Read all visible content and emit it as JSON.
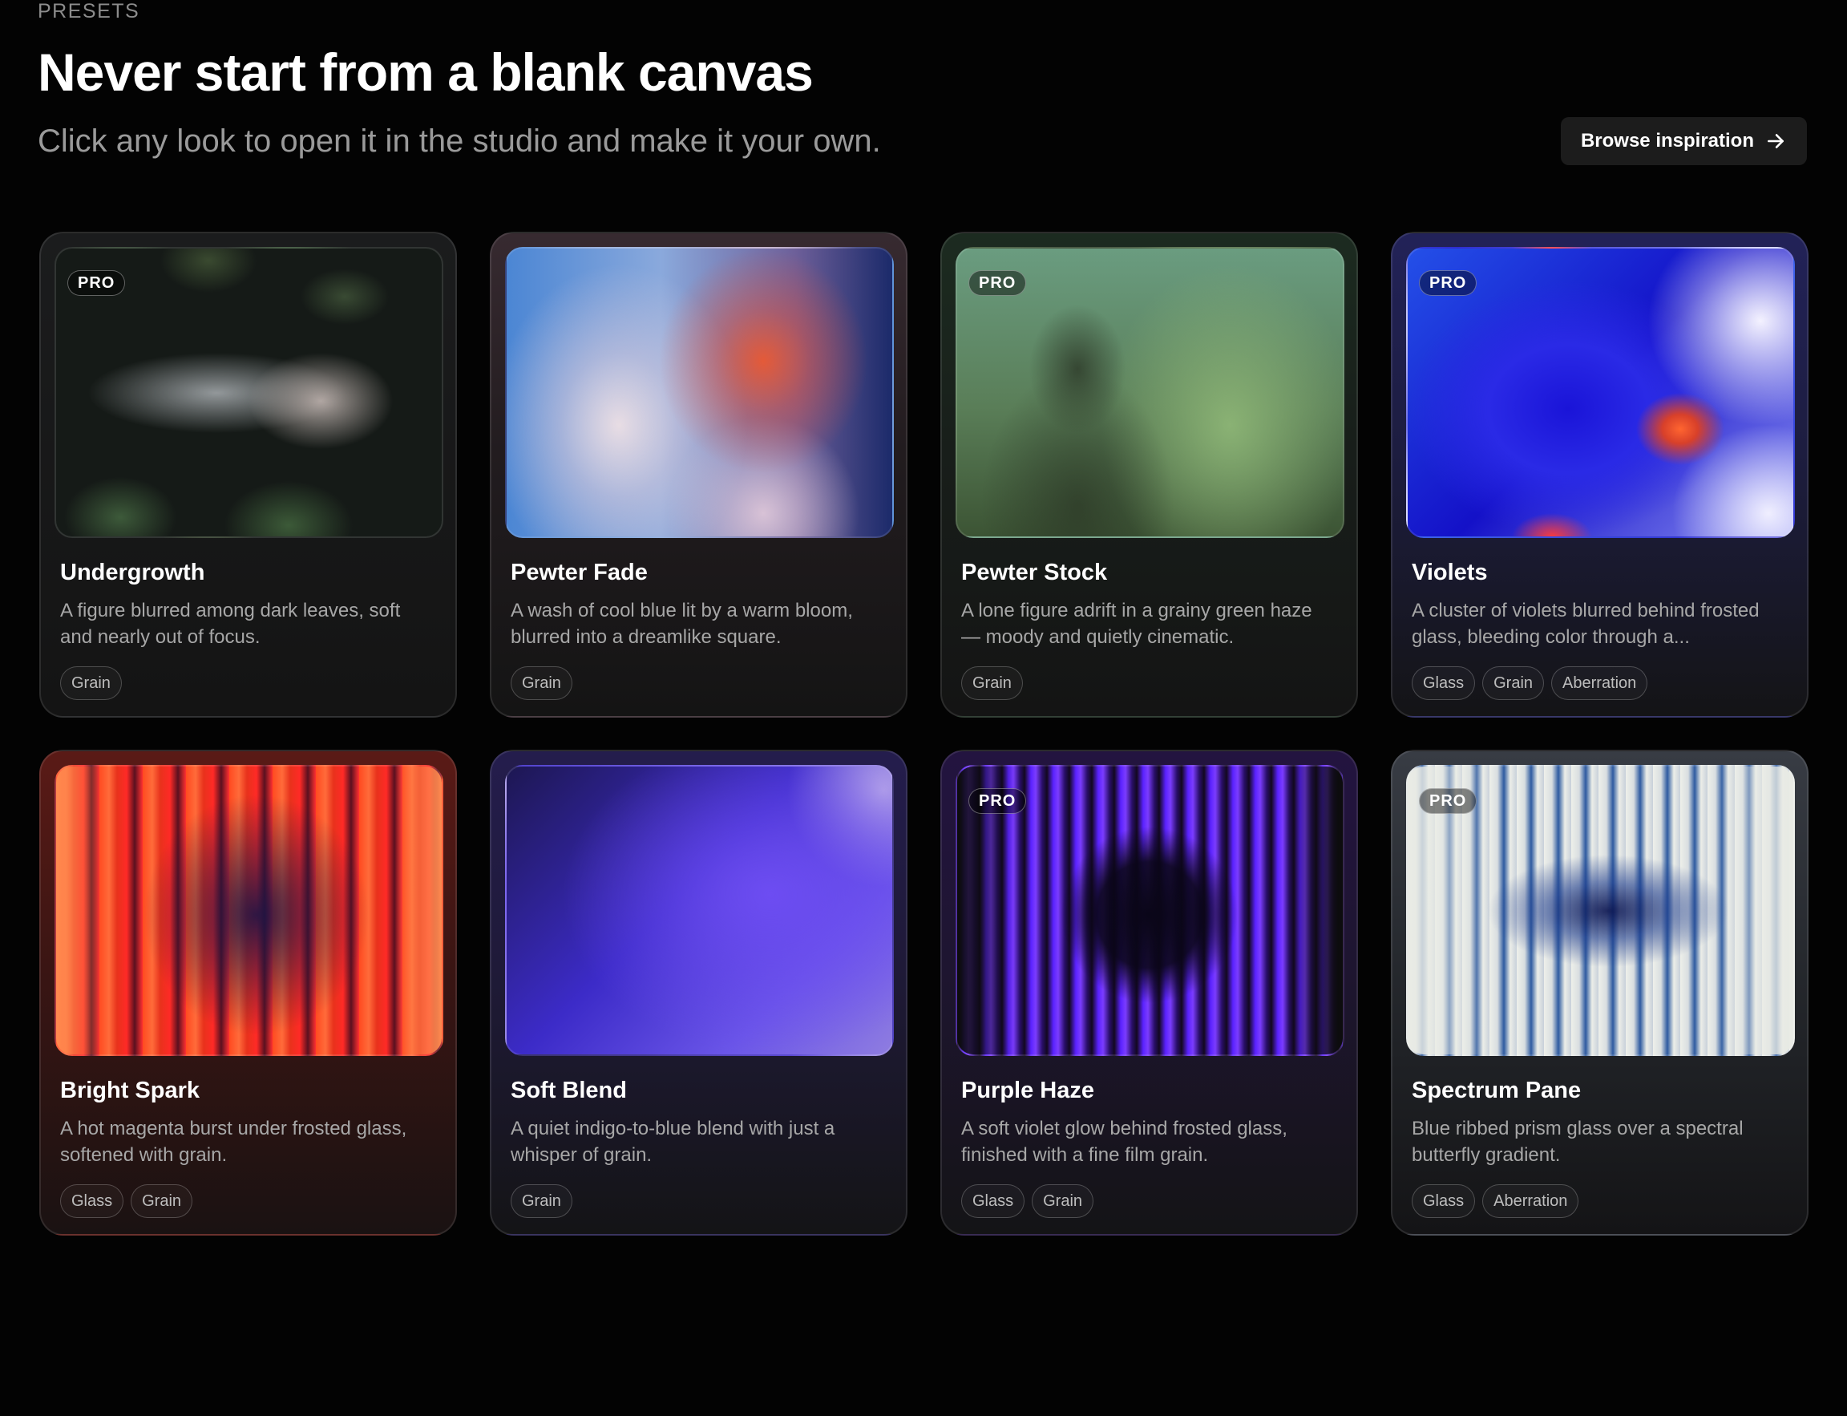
{
  "header": {
    "eyebrow": "PRESETS",
    "title": "Never start from a blank canvas",
    "subtitle": "Click any look to open it in the studio and make it your own.",
    "browse_button": "Browse inspiration",
    "browse_icon": "arrow-right-icon"
  },
  "pro_label": "PRO",
  "presets": [
    {
      "title": "Undergrowth",
      "description": "A figure blurred among dark leaves, soft and nearly out of focus.",
      "pro": true,
      "tags": [
        "Grain"
      ]
    },
    {
      "title": "Pewter Fade",
      "description": "A wash of cool blue lit by a warm bloom, blurred into a dreamlike square.",
      "pro": false,
      "tags": [
        "Grain"
      ]
    },
    {
      "title": "Pewter Stock",
      "description": "A lone figure adrift in a grainy green haze — moody and quietly cinematic.",
      "pro": true,
      "tags": [
        "Grain"
      ]
    },
    {
      "title": "Violets",
      "description": "A cluster of violets blurred behind frosted glass, bleeding color through a...",
      "pro": true,
      "tags": [
        "Glass",
        "Grain",
        "Aberration"
      ]
    },
    {
      "title": "Bright Spark",
      "description": "A hot magenta burst under frosted glass, softened with grain.",
      "pro": false,
      "tags": [
        "Glass",
        "Grain"
      ]
    },
    {
      "title": "Soft Blend",
      "description": "A quiet indigo-to-blue blend with just a whisper of grain.",
      "pro": false,
      "tags": [
        "Grain"
      ]
    },
    {
      "title": "Purple Haze",
      "description": "A soft violet glow behind frosted glass, finished with a fine film grain.",
      "pro": true,
      "tags": [
        "Glass",
        "Grain"
      ]
    },
    {
      "title": "Spectrum Pane",
      "description": "Blue ribbed prism glass over a spectral butterfly gradient.",
      "pro": true,
      "tags": [
        "Glass",
        "Aberration"
      ]
    }
  ]
}
